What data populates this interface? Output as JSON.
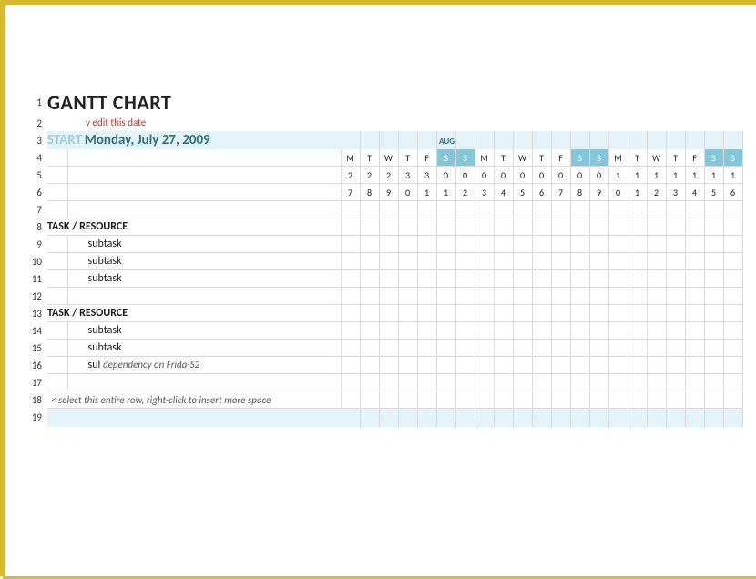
{
  "chart_data": {
    "type": "table",
    "title": "GANTT CHART",
    "start_date": "Monday, July 27, 2009",
    "calendar_month": "AUG",
    "days": [
      {
        "dow": "M",
        "date": 27,
        "weekend": false
      },
      {
        "dow": "T",
        "date": 28,
        "weekend": false
      },
      {
        "dow": "W",
        "date": 29,
        "weekend": false
      },
      {
        "dow": "T",
        "date": 30,
        "weekend": false
      },
      {
        "dow": "F",
        "date": 31,
        "weekend": false
      },
      {
        "dow": "S",
        "date": 1,
        "weekend": true
      },
      {
        "dow": "S",
        "date": 2,
        "weekend": true
      },
      {
        "dow": "M",
        "date": 3,
        "weekend": false
      },
      {
        "dow": "T",
        "date": 4,
        "weekend": false
      },
      {
        "dow": "W",
        "date": 5,
        "weekend": false
      },
      {
        "dow": "T",
        "date": 6,
        "weekend": false
      },
      {
        "dow": "F",
        "date": 7,
        "weekend": false
      },
      {
        "dow": "S",
        "date": 8,
        "weekend": true
      },
      {
        "dow": "S",
        "date": 9,
        "weekend": true
      },
      {
        "dow": "M",
        "date": 10,
        "weekend": false
      },
      {
        "dow": "T",
        "date": 11,
        "weekend": false
      },
      {
        "dow": "W",
        "date": 12,
        "weekend": false
      },
      {
        "dow": "T",
        "date": 13,
        "weekend": false
      },
      {
        "dow": "F",
        "date": 14,
        "weekend": false
      },
      {
        "dow": "S",
        "date": 15,
        "weekend": true
      },
      {
        "dow": "S",
        "date": 16,
        "weekend": true
      }
    ],
    "rows": [
      {
        "n": 1,
        "kind": "title"
      },
      {
        "n": 2,
        "kind": "hint"
      },
      {
        "n": 3,
        "kind": "start"
      },
      {
        "n": 4,
        "kind": "dow"
      },
      {
        "n": 5,
        "kind": "dnum_top"
      },
      {
        "n": 6,
        "kind": "dnum_bot"
      },
      {
        "n": 7,
        "kind": "blank"
      },
      {
        "n": 8,
        "kind": "taskhdr",
        "text": "TASK / RESOURCE"
      },
      {
        "n": 9,
        "kind": "subtask",
        "text": "subtask"
      },
      {
        "n": 10,
        "kind": "subtask",
        "text": "subtask"
      },
      {
        "n": 11,
        "kind": "subtask",
        "text": "subtask"
      },
      {
        "n": 12,
        "kind": "blank"
      },
      {
        "n": 13,
        "kind": "taskhdr",
        "text": "TASK / RESOURCE"
      },
      {
        "n": 14,
        "kind": "subtask",
        "text": "subtask"
      },
      {
        "n": 15,
        "kind": "subtask",
        "text": "subtask"
      },
      {
        "n": 16,
        "kind": "dep",
        "prefix": "sul",
        "text": "dependency on Frida-S2"
      },
      {
        "n": 17,
        "kind": "blank"
      },
      {
        "n": 18,
        "kind": "insert",
        "text": "< select this entire row, right-click to insert more space"
      },
      {
        "n": 19,
        "kind": "bottomband"
      }
    ]
  },
  "labels": {
    "title": "GANTT CHART",
    "edit_hint_prefix": "v ",
    "edit_hint": "edit this date",
    "start_label": "START",
    "start_date": "Monday, July 27, 2009",
    "month": "AUG",
    "watermark": ""
  }
}
